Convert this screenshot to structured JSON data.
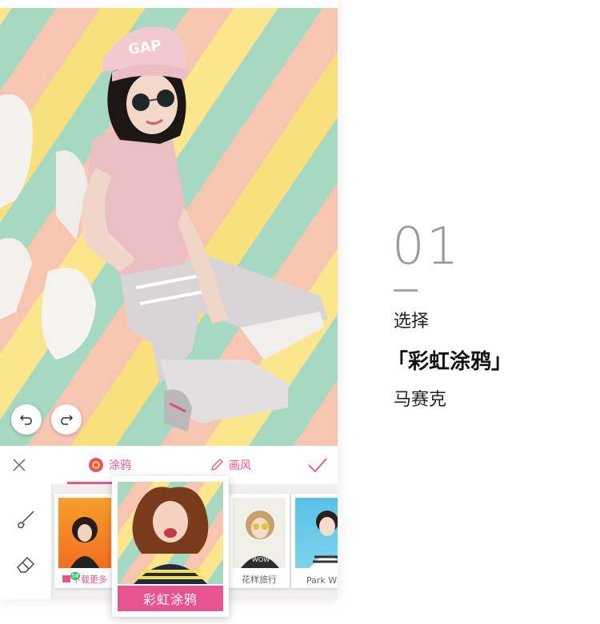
{
  "toolbar": {
    "close_icon": "close-icon",
    "tab_doodle": "涂鸦",
    "tab_paint": "画风",
    "confirm_icon": "check-icon"
  },
  "canvas": {
    "undo_icon": "undo-icon",
    "redo_icon": "redo-icon"
  },
  "tools": {
    "brush_icon": "brush-icon",
    "eraser_icon": "eraser-icon"
  },
  "gallery": {
    "items": [
      {
        "label": "下载更多",
        "badge": "58"
      },
      {
        "label": "彩虹涂鸦"
      },
      {
        "label": "花样旅行"
      },
      {
        "label": "Park W"
      }
    ]
  },
  "caption": {
    "step": "01",
    "line1": "选择",
    "line2": "「彩虹涂鸦」",
    "line3": "马赛克"
  },
  "colors": {
    "accent": "#e8538e",
    "stripe_peach": "#f6c6b0",
    "stripe_mint": "#a7d8c1",
    "stripe_yellow": "#fbe58d"
  }
}
